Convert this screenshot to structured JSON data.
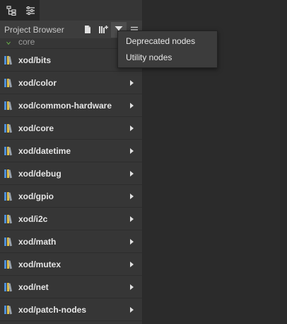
{
  "toolbar": {
    "icons": [
      "project-tree-icon",
      "settings-sliders-icon"
    ]
  },
  "project_browser": {
    "title": "Project Browser",
    "header_icons": [
      "new-patch-icon",
      "add-library-icon",
      "filter-icon",
      "menu-icon"
    ]
  },
  "filter_menu": {
    "items": [
      "Deprecated nodes",
      "Utility nodes"
    ]
  },
  "libraries": [
    {
      "name": "xod/bits"
    },
    {
      "name": "xod/color"
    },
    {
      "name": "xod/common-hardware"
    },
    {
      "name": "xod/core"
    },
    {
      "name": "xod/datetime"
    },
    {
      "name": "xod/debug"
    },
    {
      "name": "xod/gpio"
    },
    {
      "name": "xod/i2c"
    },
    {
      "name": "xod/math"
    },
    {
      "name": "xod/mutex"
    },
    {
      "name": "xod/net"
    },
    {
      "name": "xod/patch-nodes"
    }
  ],
  "partial_row_label": "core",
  "colors": {
    "lib_book_blue": "#4f8fd6",
    "lib_book_yellow": "#e0c04a",
    "lib_book_gray": "#9aa3ad",
    "project_icon_green": "#6fbf4b"
  }
}
